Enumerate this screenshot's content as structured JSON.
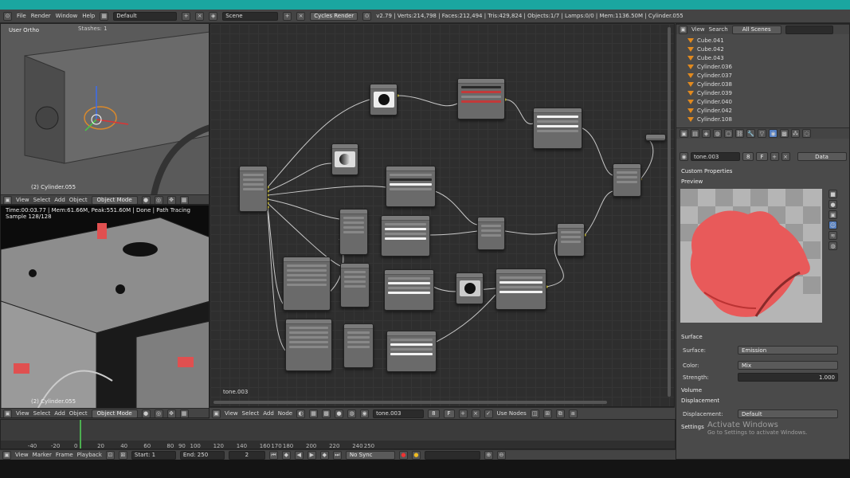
{
  "topbar": {
    "menus": [
      "File",
      "Render",
      "Window",
      "Help"
    ],
    "screen_layout": "Default",
    "scene": "Scene",
    "render_engine": "Cycles Render",
    "stats": "v2.79 | Verts:214,798 | Faces:212,494 | Tris:429,824 | Objects:1/7 | Lamps:0/0 | Mem:1136.50M | Cylinder.055"
  },
  "viewport_top": {
    "view_name": "User Ortho",
    "stashes": "Stashes: 1",
    "object_label": "(2) Cylinder.055",
    "menus": [
      "View",
      "Select",
      "Add",
      "Object"
    ],
    "mode": "Object Mode"
  },
  "viewport_bottom": {
    "render_status": "Time:00:03.77 | Mem:61.66M, Peak:551.60M | Done | Path Tracing Sample 128/128",
    "object_label": "(2) Cylinder.055",
    "menus": [
      "View",
      "Select",
      "Add",
      "Object"
    ],
    "mode": "Object Mode"
  },
  "node_editor": {
    "material_label": "tone.003",
    "menus": [
      "View",
      "Select",
      "Add",
      "Node"
    ],
    "material_field": "tone.003",
    "users": "8",
    "fake_user": "F",
    "use_nodes": "Use Nodes"
  },
  "outliner": {
    "menus": [
      "View",
      "Search"
    ],
    "scope": "All Scenes",
    "items": [
      "Cube.041",
      "Cube.042",
      "Cube.043",
      "Cylinder.036",
      "Cylinder.037",
      "Cylinder.038",
      "Cylinder.039",
      "Cylinder.040",
      "Cylinder.042",
      "Cylinder.108"
    ]
  },
  "properties": {
    "material_name": "tone.003",
    "users": "8",
    "fake_user": "F",
    "link": "Data",
    "custom_properties": "Custom Properties",
    "preview": "Preview",
    "surface_header": "Surface",
    "surface_label": "Surface:",
    "surface_value": "Emission",
    "color_label": "Color:",
    "color_value": "Mix",
    "strength_label": "Strength:",
    "strength_value": "1.000",
    "volume": "Volume",
    "displacement_header": "Displacement",
    "displacement_label": "Displacement:",
    "displacement_value": "Default",
    "settings": "Settings"
  },
  "watermark": {
    "line1": "Activate Windows",
    "line2": "Go to Settings to activate Windows."
  },
  "timeline": {
    "ticks": [
      "-40",
      "-20",
      "0",
      "20",
      "40",
      "60",
      "80",
      "90",
      "100",
      "120",
      "140",
      "160",
      "170",
      "180",
      "200",
      "220",
      "240",
      "250"
    ],
    "current_frame_value": 2,
    "menus": [
      "View",
      "Marker",
      "Frame",
      "Playback"
    ],
    "start": "Start:",
    "start_value": "1",
    "end": "End:",
    "end_value": "250",
    "frame": "2",
    "sync": "No Sync"
  }
}
